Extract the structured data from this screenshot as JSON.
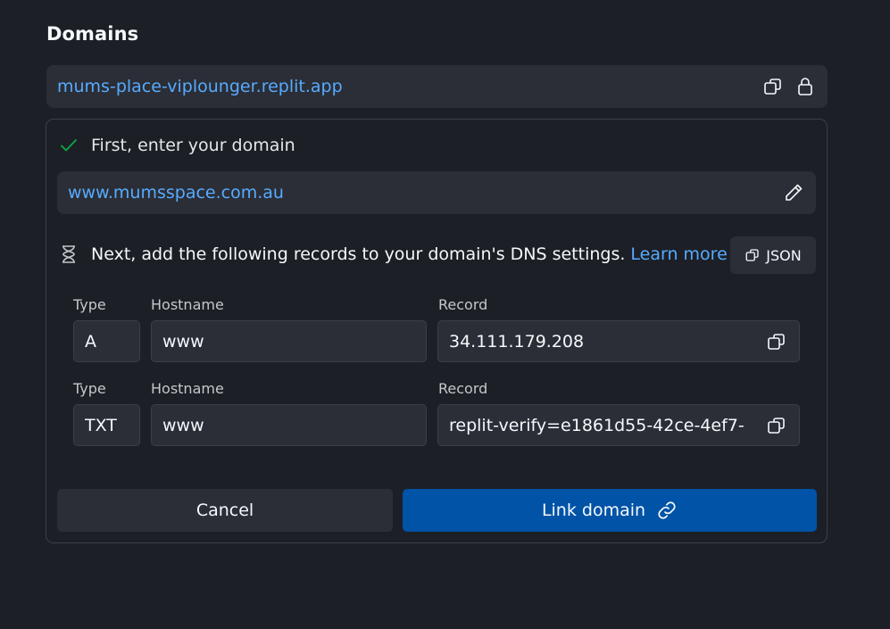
{
  "section": {
    "title": "Domains"
  },
  "existing_domain": {
    "url": "mums-place-viplounger.replit.app"
  },
  "step1": {
    "label": "First, enter your domain",
    "status": "done"
  },
  "domain_input": {
    "value": "www.mumsspace.com.au"
  },
  "step2": {
    "label": "Next, add the following records to your domain's DNS settings.",
    "learn_more": "Learn more",
    "status": "pending"
  },
  "json_button": {
    "label": "JSON"
  },
  "records": [
    {
      "type_label": "Type",
      "hostname_label": "Hostname",
      "record_label": "Record",
      "type": "A",
      "hostname": "www",
      "record": "34.111.179.208"
    },
    {
      "type_label": "Type",
      "hostname_label": "Hostname",
      "record_label": "Record",
      "type": "TXT",
      "hostname": "www",
      "record": "replit-verify=e1861d55-42ce-4ef7-"
    }
  ],
  "actions": {
    "cancel": "Cancel",
    "link": "Link domain"
  },
  "colors": {
    "background": "#1c1f26",
    "surface": "#2b2e36",
    "border": "#3c3f48",
    "link": "#57abff",
    "primary": "#0053a6",
    "success": "#0ca844"
  },
  "icons": {
    "copy": "copy-icon",
    "lock": "lock-icon",
    "check": "check-icon",
    "edit": "pencil-icon",
    "hourglass": "hourglass-icon",
    "link": "link-icon"
  }
}
